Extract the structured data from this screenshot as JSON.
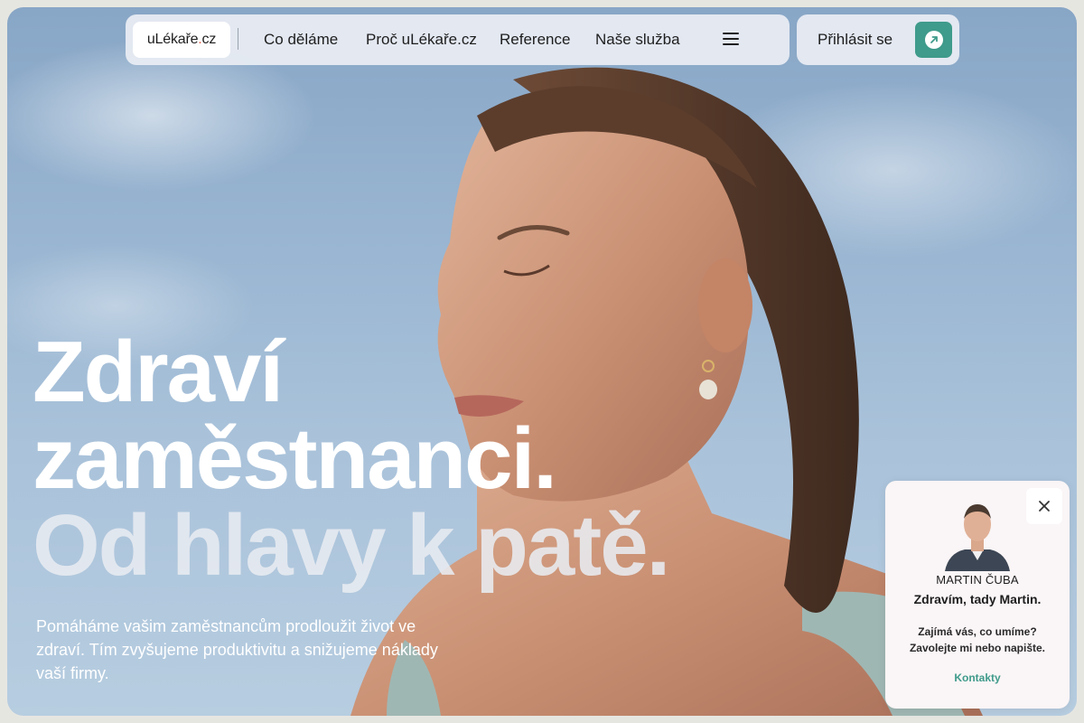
{
  "brand": {
    "logo_text": "uLékaře",
    "logo_dot": ".",
    "logo_suffix": "cz"
  },
  "nav": {
    "links": [
      "Co děláme",
      "Proč uLékaře.cz",
      "Reference",
      "Naše služba"
    ],
    "menu_icon": "hamburger-menu-icon",
    "login_label": "Přihlásit se",
    "login_icon": "arrow-up-right-icon"
  },
  "hero": {
    "line1": "Zdraví",
    "line2": "zaměstnanci.",
    "line3": "Od hlavy k patě.",
    "subtitle": "Pomáháme vašim zaměstnancům prodloužit život ve zdraví. Tím zvyšujeme produktivitu a snižujeme náklady vaší firmy."
  },
  "chat": {
    "name": "MARTIN ČUBA",
    "greeting": "Zdravím, tady Martin.",
    "message": "Zajímá vás, co umíme? Zavolejte mi nebo napište.",
    "link_label": "Kontakty",
    "close_icon": "close-icon"
  },
  "colors": {
    "accent": "#3f9b8b",
    "logo_dot": "#e05a47",
    "nav_bg": "#eaeef4",
    "page_bg": "#e6e6e1"
  }
}
